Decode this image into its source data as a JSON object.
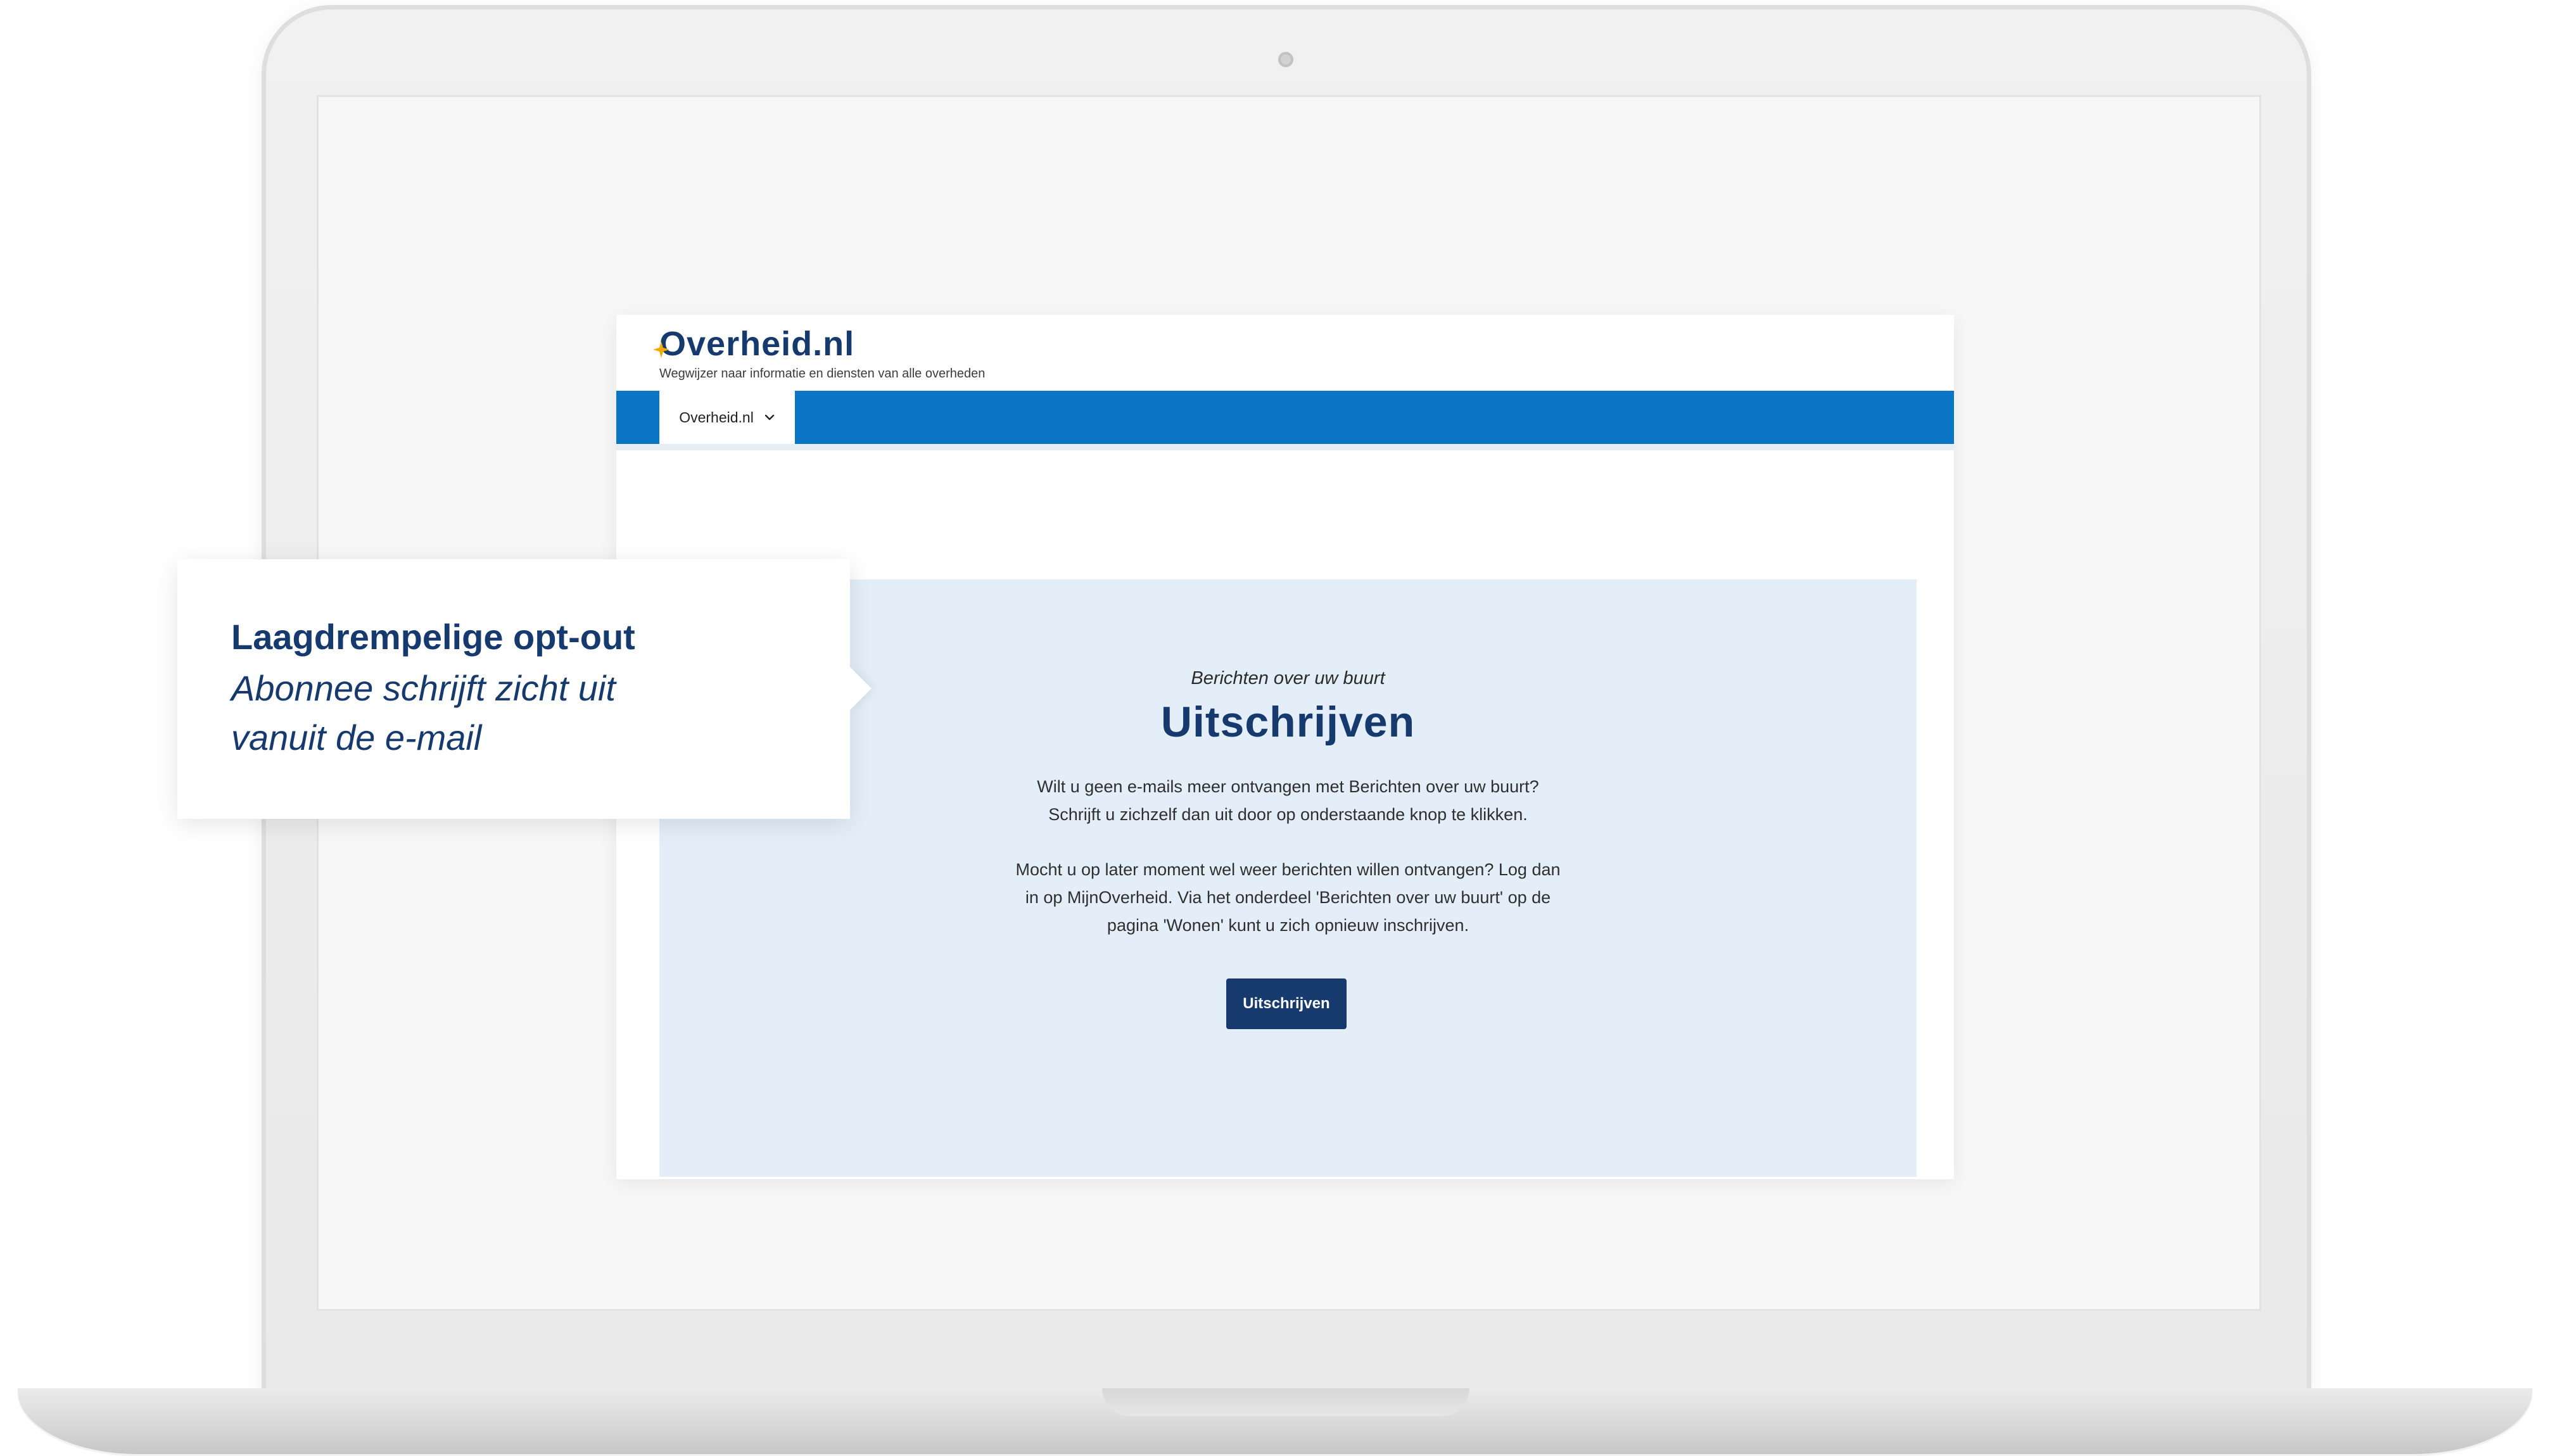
{
  "site": {
    "logo_text": "Overheid",
    "logo_suffix": ".nl",
    "tagline": "Wegwijzer naar informatie en diensten van alle overheden",
    "nav": {
      "tab_label": "Overheid.nl"
    }
  },
  "panel": {
    "kicker": "Berichten over uw buurt",
    "title": "Uitschrijven",
    "paragraph1": [
      "Wilt u geen e-mails meer ontvangen met Berichten over uw buurt?",
      "Schrijft u zichzelf dan uit door op onderstaande knop te klikken."
    ],
    "paragraph2": [
      "Mocht u op later moment wel weer berichten willen ontvangen? Log dan",
      "in op MijnOverheid. Via het onderdeel 'Berichten over uw buurt' op de",
      "pagina 'Wonen' kunt u zich opnieuw inschrijven."
    ],
    "button_label": "Uitschrijven"
  },
  "callout": {
    "title": "Laagdrempelige opt-out",
    "body": [
      "Abonnee schrijft zicht uit",
      "vanuit de e-mail"
    ]
  },
  "icons": {
    "logo_mark": "overheid-logo-spark-icon",
    "nav_chevron": "chevron-down-icon"
  },
  "colors": {
    "brand_dark_blue": "#163a6e",
    "nav_blue": "#0a74c5",
    "panel_bg": "#e3eef8",
    "logo_accent": "#f2a900"
  }
}
